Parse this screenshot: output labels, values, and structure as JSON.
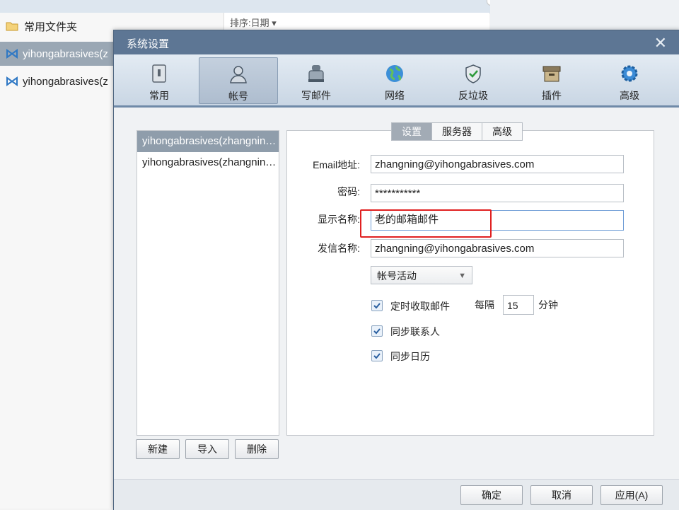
{
  "background": {
    "folders": [
      {
        "label": "常用文件夹",
        "icon": "folder-icon"
      },
      {
        "label": "yihongabrasives(z",
        "icon": "account-icon",
        "selected": true
      },
      {
        "label": "yihongabrasives(z",
        "icon": "account-icon",
        "selected": false
      }
    ],
    "sort_label": "排序:日期 ▾"
  },
  "dialog": {
    "title": "系统设置",
    "close_glyph": "✕",
    "toolbar": [
      {
        "label": "常用",
        "icon": "general-icon"
      },
      {
        "label": "帐号",
        "icon": "account-user-icon",
        "selected": true
      },
      {
        "label": "写邮件",
        "icon": "compose-icon"
      },
      {
        "label": "网络",
        "icon": "network-globe-icon"
      },
      {
        "label": "反垃圾",
        "icon": "antispam-shield-icon"
      },
      {
        "label": "插件",
        "icon": "plugin-box-icon"
      },
      {
        "label": "高级",
        "icon": "advanced-gear-icon"
      }
    ],
    "accounts": [
      {
        "label": "yihongabrasives(zhangning@yihongabrasives.com)",
        "selected": true
      },
      {
        "label": "yihongabrasives(zhangning@yihongabrasives.com)",
        "selected": false
      }
    ],
    "account_buttons": {
      "new": "新建",
      "import": "导入",
      "delete": "删除"
    },
    "tabs": [
      {
        "label": "设置",
        "selected": true
      },
      {
        "label": "服务器"
      },
      {
        "label": "高级"
      }
    ],
    "form": {
      "email_label": "Email地址:",
      "email_value": "zhangning@yihongabrasives.com",
      "password_label": "密码:",
      "password_value": "***********",
      "display_label": "显示名称:",
      "display_value": "老的邮箱邮件",
      "sender_label": "发信名称:",
      "sender_value": "zhangning@yihongabrasives.com",
      "status_select": "帐号活动",
      "check_mail_label": "定时收取邮件",
      "check_mail_checked": true,
      "interval_prefix": "每隔",
      "interval_value": "15",
      "interval_unit": "分钟",
      "sync_contacts_label": "同步联系人",
      "sync_contacts_checked": true,
      "sync_calendar_label": "同步日历",
      "sync_calendar_checked": true
    },
    "footer_buttons": {
      "ok": "确定",
      "cancel": "取消",
      "apply": "应用(A)"
    },
    "colors": {
      "titlebar": "#5d7694",
      "highlight_box": "#e02020",
      "selected_row": "#8f9dab"
    }
  }
}
